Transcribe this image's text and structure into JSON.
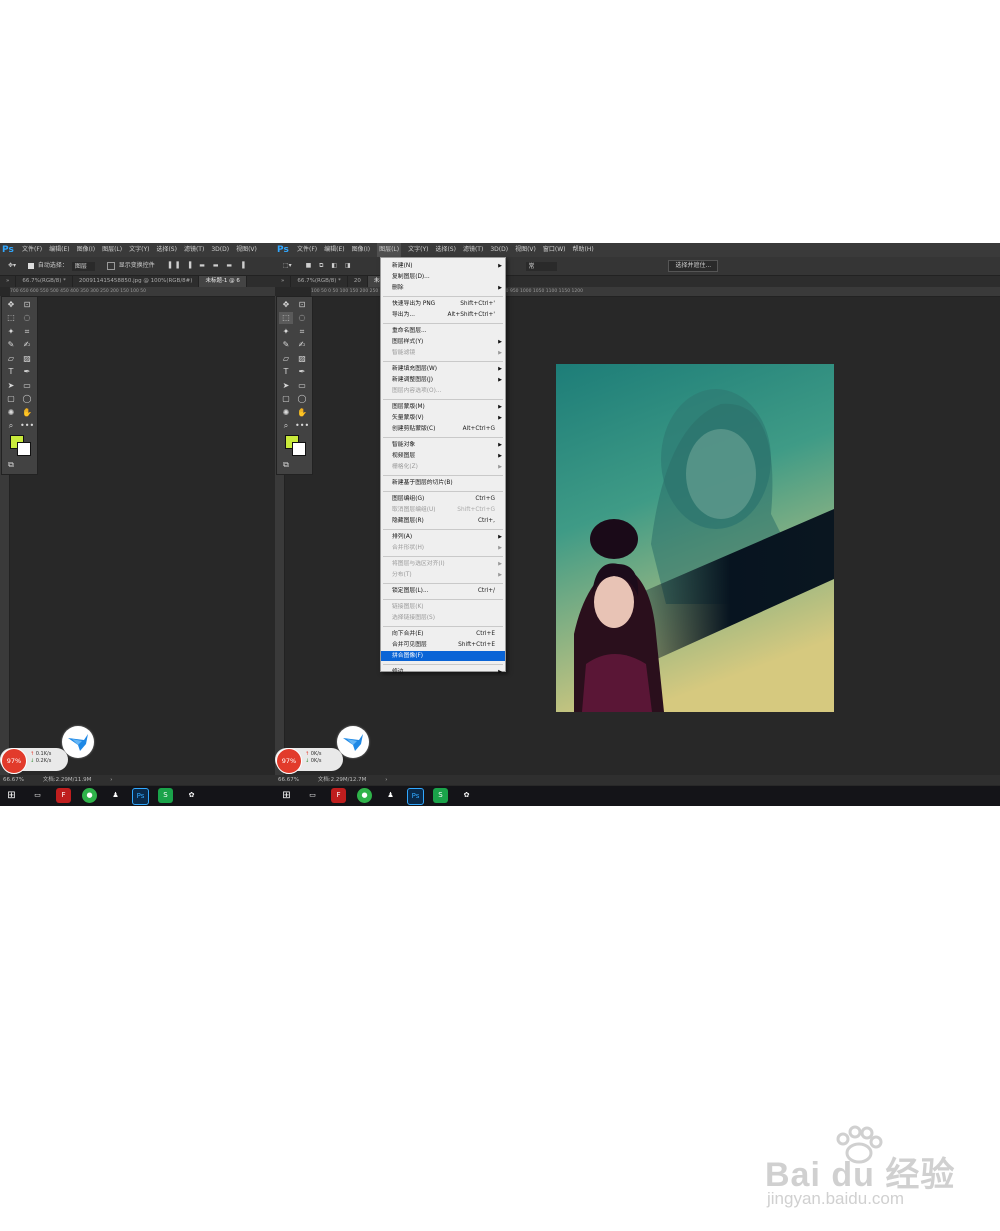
{
  "app": {
    "logo": "Ps"
  },
  "menubar": {
    "items": [
      "文件(F)",
      "编辑(E)",
      "图像(I)",
      "图层(L)",
      "文字(Y)",
      "选择(S)",
      "滤镜(T)",
      "3D(D)",
      "视图(V)",
      "窗口(W)",
      "帮助(H)"
    ]
  },
  "left_menubar": {
    "items": [
      "文件(F)",
      "编辑(E)",
      "图像(I)",
      "图层(L)",
      "文字(Y)",
      "选择(S)",
      "滤镜(T)",
      "3D(D)",
      "视图(V)"
    ]
  },
  "options": {
    "auto_select_label": "自动选择：",
    "auto_select_value": "图层",
    "show_transform_label": "显示变换控件",
    "mode_value": "常",
    "select_subject_button": "选择并遮住..."
  },
  "left_tabs": [
    "66.7%(RGB/8) *",
    "200911415458850.jpg @ 100%(RGB/8#)",
    "未标题-1 @ 6"
  ],
  "right_tabs": [
    "66.7%(RGB/8) *",
    "20",
    "未标题-1 @ 66.7% (人物, RGB/8#) *"
  ],
  "ruler_left": "700  650  600  550  500  450  400  350  300  250  200  150  100  50",
  "ruler_right": "100  50  0  50  100  150  200  250  300  350  400  450  500  550  600  650  700  750  800  850  900  950  1000  1050  1100  1150  1200",
  "colors": {
    "foreground": "#c9ea3b",
    "background": "#ffffff",
    "accent": "#0a64d6"
  },
  "layer_menu": {
    "items": [
      {
        "label": "新建(N)",
        "shortcut": "",
        "submenu": true,
        "disabled": false
      },
      {
        "label": "复制图层(D)...",
        "shortcut": "",
        "submenu": false,
        "disabled": false
      },
      {
        "label": "删除",
        "shortcut": "",
        "submenu": true,
        "disabled": false
      },
      {
        "label": "快速导出为 PNG",
        "shortcut": "Shift+Ctrl+'",
        "submenu": false,
        "disabled": false
      },
      {
        "label": "导出为...",
        "shortcut": "Alt+Shift+Ctrl+'",
        "submenu": false,
        "disabled": false
      },
      {
        "label": "重命名图层...",
        "shortcut": "",
        "submenu": false,
        "disabled": false
      },
      {
        "label": "图层样式(Y)",
        "shortcut": "",
        "submenu": true,
        "disabled": false
      },
      {
        "label": "智能滤镜",
        "shortcut": "",
        "submenu": true,
        "disabled": true
      },
      {
        "label": "新建填充图层(W)",
        "shortcut": "",
        "submenu": true,
        "disabled": false
      },
      {
        "label": "新建调整图层(J)",
        "shortcut": "",
        "submenu": true,
        "disabled": false
      },
      {
        "label": "图层内容选项(O)...",
        "shortcut": "",
        "submenu": false,
        "disabled": true
      },
      {
        "label": "图层蒙版(M)",
        "shortcut": "",
        "submenu": true,
        "disabled": false
      },
      {
        "label": "矢量蒙版(V)",
        "shortcut": "",
        "submenu": true,
        "disabled": false
      },
      {
        "label": "创建剪贴蒙版(C)",
        "shortcut": "Alt+Ctrl+G",
        "submenu": false,
        "disabled": false
      },
      {
        "label": "智能对象",
        "shortcut": "",
        "submenu": true,
        "disabled": false
      },
      {
        "label": "视频图层",
        "shortcut": "",
        "submenu": true,
        "disabled": false
      },
      {
        "label": "栅格化(Z)",
        "shortcut": "",
        "submenu": true,
        "disabled": true
      },
      {
        "label": "新建基于图层的切片(B)",
        "shortcut": "",
        "submenu": false,
        "disabled": false
      },
      {
        "label": "图层编组(G)",
        "shortcut": "Ctrl+G",
        "submenu": false,
        "disabled": false
      },
      {
        "label": "取消图层编组(U)",
        "shortcut": "Shift+Ctrl+G",
        "submenu": false,
        "disabled": true
      },
      {
        "label": "隐藏图层(R)",
        "shortcut": "Ctrl+,",
        "submenu": false,
        "disabled": false
      },
      {
        "label": "排列(A)",
        "shortcut": "",
        "submenu": true,
        "disabled": false
      },
      {
        "label": "合并形状(H)",
        "shortcut": "",
        "submenu": true,
        "disabled": true
      },
      {
        "label": "将图层与选区对齐(I)",
        "shortcut": "",
        "submenu": true,
        "disabled": true
      },
      {
        "label": "分布(T)",
        "shortcut": "",
        "submenu": true,
        "disabled": true
      },
      {
        "label": "锁定图层(L)...",
        "shortcut": "Ctrl+/",
        "submenu": false,
        "disabled": false
      },
      {
        "label": "链接图层(K)",
        "shortcut": "",
        "submenu": false,
        "disabled": true
      },
      {
        "label": "选择链接图层(S)",
        "shortcut": "",
        "submenu": false,
        "disabled": true
      },
      {
        "label": "向下合并(E)",
        "shortcut": "Ctrl+E",
        "submenu": false,
        "disabled": false
      },
      {
        "label": "合并可见图层",
        "shortcut": "Shift+Ctrl+E",
        "submenu": false,
        "disabled": false
      },
      {
        "label": "拼合图像(F)",
        "shortcut": "",
        "submenu": false,
        "disabled": false,
        "selected": true
      },
      {
        "label": "修边",
        "shortcut": "",
        "submenu": true,
        "disabled": false
      }
    ]
  },
  "status_left": {
    "zoom": "66.67%",
    "doc": "文档:2.29M/11.9M"
  },
  "status_right": {
    "zoom": "66.67%",
    "doc": "文档:2.29M/12.7M"
  },
  "net_left": {
    "percent": "97%",
    "up": "0.1K/s",
    "down": "0.2K/s"
  },
  "net_right": {
    "percent": "97%",
    "up": "0K/s",
    "down": "0K/s"
  },
  "watermark": {
    "brand": "Bai du 经验",
    "url": "jingyan.baidu.com"
  }
}
